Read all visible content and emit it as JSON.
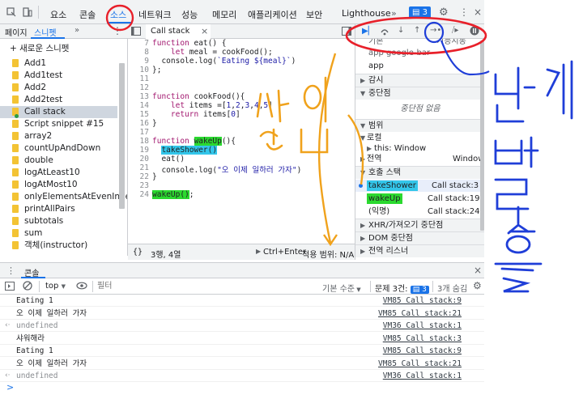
{
  "top_tabs": [
    {
      "label": "요소"
    },
    {
      "label": "콘솔"
    },
    {
      "label": "소스"
    },
    {
      "label": "네트워크"
    },
    {
      "label": "성능"
    },
    {
      "label": "메모리"
    },
    {
      "label": "애플리케이션"
    },
    {
      "label": "보안"
    },
    {
      "label": "Lighthouse"
    }
  ],
  "top_bar": {
    "more": "»",
    "issues_badge": "3"
  },
  "navigator": {
    "tabs": [
      {
        "label": "페이지"
      },
      {
        "label": "스니펫"
      }
    ],
    "more": "»",
    "new_snippet": "+ 새로운 스니펫",
    "files": [
      {
        "name": "Add1"
      },
      {
        "name": "Add1test"
      },
      {
        "name": "Add2"
      },
      {
        "name": "Add2test"
      },
      {
        "name": "Call stack"
      },
      {
        "name": "Script snippet #15"
      },
      {
        "name": "array2"
      },
      {
        "name": "countUpAndDown"
      },
      {
        "name": "double"
      },
      {
        "name": "logAtLeast10"
      },
      {
        "name": "logAtMost10"
      },
      {
        "name": "onlyElementsAtEvenIndex"
      },
      {
        "name": "printAllPairs"
      },
      {
        "name": "subtotals"
      },
      {
        "name": "sum"
      },
      {
        "name": "객체(instructor)"
      }
    ]
  },
  "editor": {
    "tab_label": "Call stack",
    "tab_close": "×",
    "line_numbers": [
      "7",
      "8",
      "9",
      "10",
      "11",
      "12",
      "13",
      "14",
      "15",
      "16",
      "17",
      "18",
      "19",
      "20",
      "21",
      "22",
      "23",
      "24"
    ],
    "status": {
      "braces": "{}",
      "position": "3행, 4열",
      "run": "Ctrl+Enter",
      "scope": "적용 범위: N/A"
    }
  },
  "debugger": {
    "top_partial": "기본",
    "top_partial_right": "기능시동",
    "global_partial": "app google-bar",
    "scope_app": "app",
    "watch": "감시",
    "breakpoints": "중단점",
    "no_breakpoints": "중단점 없음",
    "scope": "범위",
    "local": "로컬",
    "this_label": "this: Window",
    "global": "전역",
    "global_value": "Window",
    "call_stack": "호출 스택",
    "frames": [
      {
        "name": "takeShower",
        "loc": "Call stack:3"
      },
      {
        "name": "wakeUp",
        "loc": "Call stack:19"
      },
      {
        "name": "(익명)",
        "loc": "Call stack:24"
      }
    ],
    "xhr": "XHR/가져오기 중단점",
    "dom": "DOM 중단점",
    "listeners": "전역 리스너"
  },
  "console": {
    "tab_label": "콘솔",
    "context": "top",
    "filter_placeholder": "필터",
    "levels": "기본 수준",
    "issues_label": "문제 3건:",
    "issues_count": "3",
    "hidden": "3개 숨김",
    "logs": [
      {
        "msg": "Eating 1",
        "src": "VM85 Call stack:9",
        "type": "log"
      },
      {
        "msg": "오 이제 일하러 가자",
        "src": "VM85 Call stack:21",
        "type": "log"
      },
      {
        "msg": "undefined",
        "src": "VM36 Call stack:1",
        "type": "ret"
      },
      {
        "msg": "샤워해라",
        "src": "VM85 Call stack:3",
        "type": "log"
      },
      {
        "msg": "Eating 1",
        "src": "VM85 Call stack:9",
        "type": "log"
      },
      {
        "msg": "오 이제 일하러 가자",
        "src": "VM85 Call stack:21",
        "type": "log"
      },
      {
        "msg": "undefined",
        "src": "VM36 Call stack:1",
        "type": "ret"
      }
    ],
    "prompt": ">"
  },
  "annotations": {
    "handwriting_1": "싸임",
    "handwriting_2": "단계별 호출"
  },
  "colors": {
    "accent": "#1a73e8",
    "red_ink": "#e8202a",
    "orange_ink": "#f0a21c",
    "blue_ink": "#1f3ed8"
  }
}
